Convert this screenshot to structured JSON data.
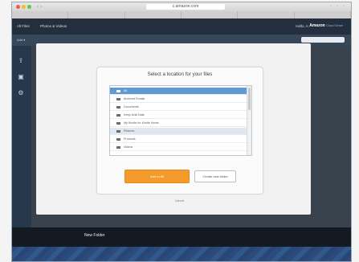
{
  "browser": {
    "url": "c.amazon.com",
    "tabs": [
      "",
      "",
      "",
      "",
      "",
      ""
    ],
    "nav": "‹ ›"
  },
  "header": {
    "nav": [
      "All Files",
      "Photos & Videos"
    ],
    "user": "Hello, A.",
    "logo": "Amazon",
    "logo_sub": "Cloud Drive"
  },
  "subbar": {
    "text": "Add ▾"
  },
  "modal": {
    "title": "Select a location for your files",
    "items": [
      {
        "label": "All",
        "state": "selected"
      },
      {
        "label": "Archived Emails",
        "state": "normal"
      },
      {
        "label": "Documents",
        "state": "normal"
      },
      {
        "label": "Keep Until Date",
        "state": "normal"
      },
      {
        "label": "My Kindle for Kindle Home",
        "state": "normal"
      },
      {
        "label": "Pictures",
        "state": "highlighted"
      },
      {
        "label": "Products",
        "state": "normal"
      },
      {
        "label": "Videos",
        "state": "normal"
      }
    ],
    "primary_label": "Add to All",
    "secondary_label": "Create new folder",
    "cancel_label": "Cancel"
  },
  "toolbar": {
    "items": [
      "New Folder",
      "",
      "",
      "",
      "",
      "",
      ""
    ]
  },
  "colors": {
    "accent": "#f59b2b",
    "selection": "#5f9ad6",
    "header": "#232f3e"
  },
  "icons": [
    "search-icon",
    "upload-icon",
    "settings-icon",
    "folder-icon",
    "close-icon"
  ]
}
